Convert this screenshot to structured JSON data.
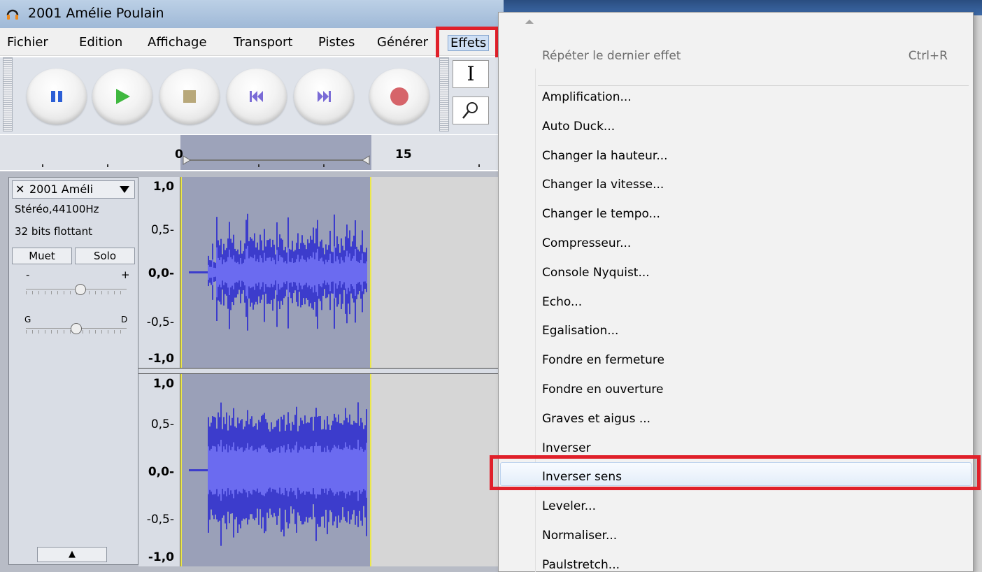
{
  "window": {
    "title": "2001 Amélie Poulain"
  },
  "menubar": {
    "items": [
      "Fichier",
      "Edition",
      "Affichage",
      "Transport",
      "Pistes",
      "Générer",
      "Effets"
    ]
  },
  "toolbar": {
    "buttons": [
      "pause",
      "play",
      "stop",
      "skip-start",
      "skip-end",
      "record"
    ],
    "tools": {
      "select": "I",
      "zoom": "zoom"
    }
  },
  "ruler": {
    "labels": [
      "0",
      "15"
    ]
  },
  "track": {
    "name": "2001 Améli",
    "close": "✕",
    "format": "Stéréo,44100Hz",
    "bits": "32 bits flottant",
    "mute": "Muet",
    "solo": "Solo",
    "gain_minus": "-",
    "gain_plus": "+",
    "pan_left": "G",
    "pan_right": "D",
    "gain_level": 0.55,
    "pan_level": 0.5,
    "collapse": "▲"
  },
  "scale": {
    "top": [
      "1,0",
      "0,5-",
      "0,0-",
      "-0,5-",
      "-1,0"
    ],
    "bottom": [
      "1,0",
      "0,5-",
      "0,0-",
      "-0,5-",
      "-1,0"
    ]
  },
  "effects_menu": {
    "repeat_label": "Répéter le dernier effet",
    "repeat_shortcut": "Ctrl+R",
    "items": [
      "Amplification...",
      "Auto Duck...",
      "Changer la hauteur...",
      "Changer la vitesse...",
      "Changer le tempo...",
      "Compresseur...",
      "Console Nyquist...",
      "Echo...",
      "Egalisation...",
      "Fondre en fermeture",
      "Fondre en ouverture",
      "Graves et aigus ...",
      "Inverser",
      "Inverser sens",
      "Leveler...",
      "Normaliser...",
      "Paulstretch..."
    ],
    "highlighted": "Inverser sens"
  },
  "colors": {
    "highlight_box": "#e0202a",
    "waveform": "#3c3ccc",
    "waveform_rms": "#6b6bf0",
    "selection": "#9aa0b8",
    "cursor": "#ece84a"
  }
}
